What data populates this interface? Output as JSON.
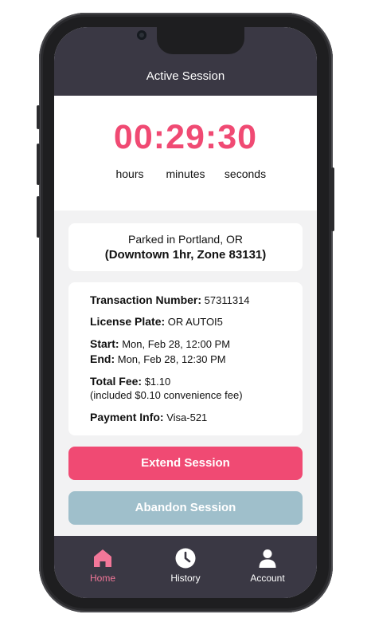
{
  "header": {
    "title": "Active Session"
  },
  "timer": {
    "display": "00:29:30",
    "units": [
      "hours",
      "minutes",
      "seconds"
    ]
  },
  "location": {
    "line1": "Parked in Portland, OR",
    "line2": "(Downtown 1hr, Zone 83131)"
  },
  "details": {
    "transaction_label": "Transaction Number:",
    "transaction_value": "57311314",
    "plate_label": "License Plate:",
    "plate_value": "OR AUTOI5",
    "start_label": "Start:",
    "start_value": "Mon, Feb 28, 12:00 PM",
    "end_label": "End:",
    "end_value": "Mon, Feb 28, 12:30 PM",
    "fee_label": "Total Fee:",
    "fee_value": "$1.10",
    "fee_note": "(included $0.10 convenience fee)",
    "payment_label": "Payment Info:",
    "payment_value": "Visa-521"
  },
  "actions": {
    "extend_label": "Extend Session",
    "abandon_label": "Abandon Session"
  },
  "nav": {
    "items": [
      {
        "label": "Home",
        "icon": "home-icon",
        "active": true
      },
      {
        "label": "History",
        "icon": "clock-icon",
        "active": false
      },
      {
        "label": "Account",
        "icon": "person-icon",
        "active": false
      }
    ]
  },
  "colors": {
    "accent": "#f04a73",
    "header_bg": "#3a3844",
    "abandon_bg": "#9fbfcb",
    "active_nav": "#f27799"
  }
}
